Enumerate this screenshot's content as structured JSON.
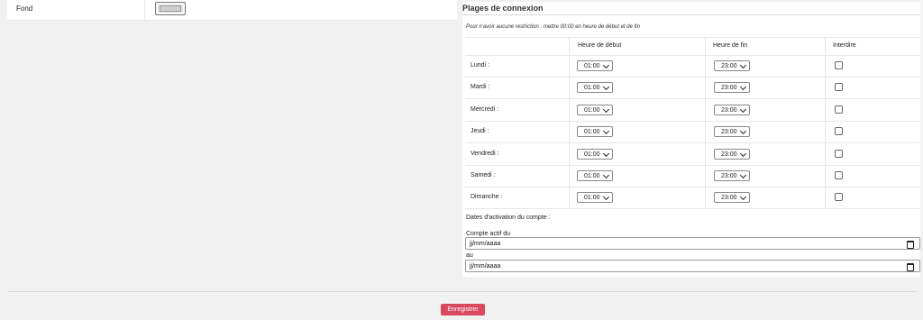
{
  "left": {
    "label": "Fond",
    "swatch_color": "#cfcfcf"
  },
  "plages": {
    "title": "Plages de connexion",
    "note": "Pour n'avoir aucune restriction : mettre 00:00 en heure de début et de fin",
    "headers": {
      "start": "Heure de début",
      "end": "Heure de fin",
      "forbid": "Interdire"
    },
    "days": [
      {
        "label": "Lundi :",
        "start": "01:00",
        "end": "23:00",
        "forbid": false
      },
      {
        "label": "Mardi :",
        "start": "01:00",
        "end": "23:00",
        "forbid": false
      },
      {
        "label": "Mercredi :",
        "start": "01:00",
        "end": "23:00",
        "forbid": false
      },
      {
        "label": "Jeudi :",
        "start": "01:00",
        "end": "23:00",
        "forbid": false
      },
      {
        "label": "Vendredi :",
        "start": "01:00",
        "end": "23:00",
        "forbid": false
      },
      {
        "label": "Samedi :",
        "start": "01:00",
        "end": "23:00",
        "forbid": false
      },
      {
        "label": "Dimanche :",
        "start": "01:00",
        "end": "23:00",
        "forbid": false
      }
    ]
  },
  "dates": {
    "title": "Dates d'activation du compte :",
    "from_label": "Compte actif du",
    "from_value": "jj/mm/aaaa",
    "to_label": "au",
    "to_value": "jj/mm/aaaa"
  },
  "footer": {
    "save_label": "Enregistrer",
    "save_color": "#d94a60"
  }
}
